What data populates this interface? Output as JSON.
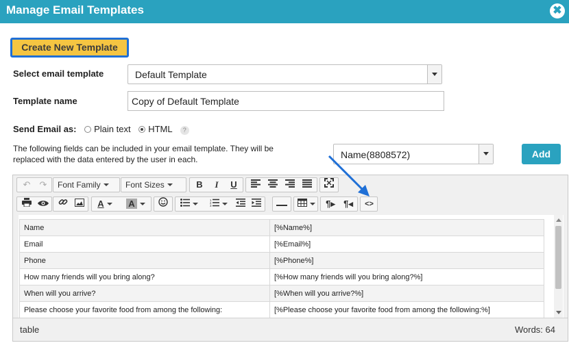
{
  "window": {
    "title": "Manage Email Templates",
    "close_label": "✖"
  },
  "create_button": "Create New Template",
  "select_template": {
    "label": "Select email template",
    "value": "Default Template"
  },
  "template_name": {
    "label": "Template name",
    "value": "Copy of Default Template"
  },
  "send_as": {
    "label": "Send Email as:",
    "options": [
      "Plain text",
      "HTML"
    ],
    "selected": "HTML",
    "help": "?"
  },
  "fields_info": "The following fields can be included in your email template. They will be replaced with the data entered by the user in each.",
  "field_select": {
    "value": "Name(8808572)"
  },
  "add_button": "Add",
  "toolbar": {
    "font_family": "Font Family",
    "font_sizes": "Font Sizes",
    "bold": "B",
    "italic": "I",
    "underline": "U",
    "text_color": "A",
    "bg_color": "A"
  },
  "table_rows": [
    [
      "Name",
      "[%Name%]"
    ],
    [
      "Email",
      "[%Email%]"
    ],
    [
      "Phone",
      "[%Phone%]"
    ],
    [
      "How many friends will you bring along?",
      "[%How many friends will you bring along?%]"
    ],
    [
      "When will you arrive?",
      "[%When will you arrive?%]"
    ],
    [
      "Please choose your favorite food from among the following:",
      "[%Please choose your favorite food from among the following:%]"
    ]
  ],
  "status": {
    "path": "table",
    "words": "Words: 64"
  },
  "colors": {
    "titlebar": "#2aa2bf",
    "create_button": "#f5c542",
    "highlight_border": "#1f6fd6",
    "annotation_arrow": "#1f6fd6"
  }
}
